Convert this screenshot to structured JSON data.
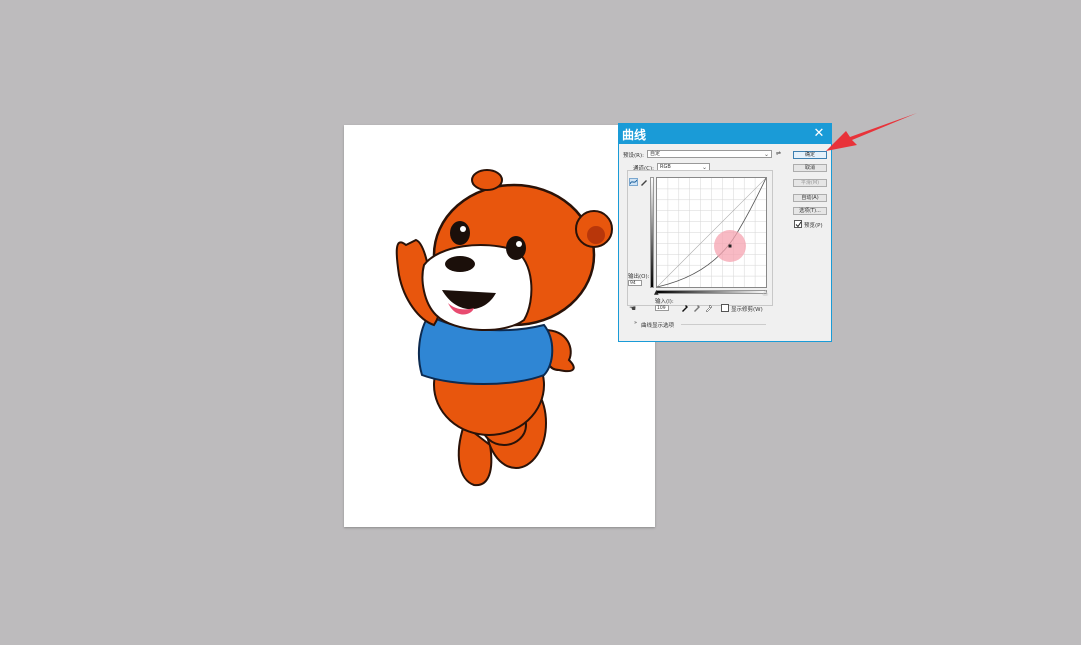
{
  "dialog": {
    "title": "曲线",
    "preset_label": "预设(R):",
    "preset_value": "自定",
    "channel_label": "通道(C):",
    "channel_value": "RGB",
    "output_label": "输出(O):",
    "output_value": "94",
    "input_label": "输入(I):",
    "input_value": "109",
    "show_clipping_label": "显示修剪(W)",
    "curve_options_label": "曲线显示选项",
    "buttons": {
      "ok": "确定",
      "cancel": "取消",
      "smooth": "平滑(M)",
      "auto": "自动(A)",
      "options": "选项(T)...",
      "preview": "预览(P)"
    }
  },
  "colors": {
    "background": "#bdbbbd",
    "titlebar": "#1a9bd7",
    "annotation_arrow": "#e8333a",
    "bear_fur": "#e8560d",
    "bear_shirt": "#2f86d4"
  }
}
